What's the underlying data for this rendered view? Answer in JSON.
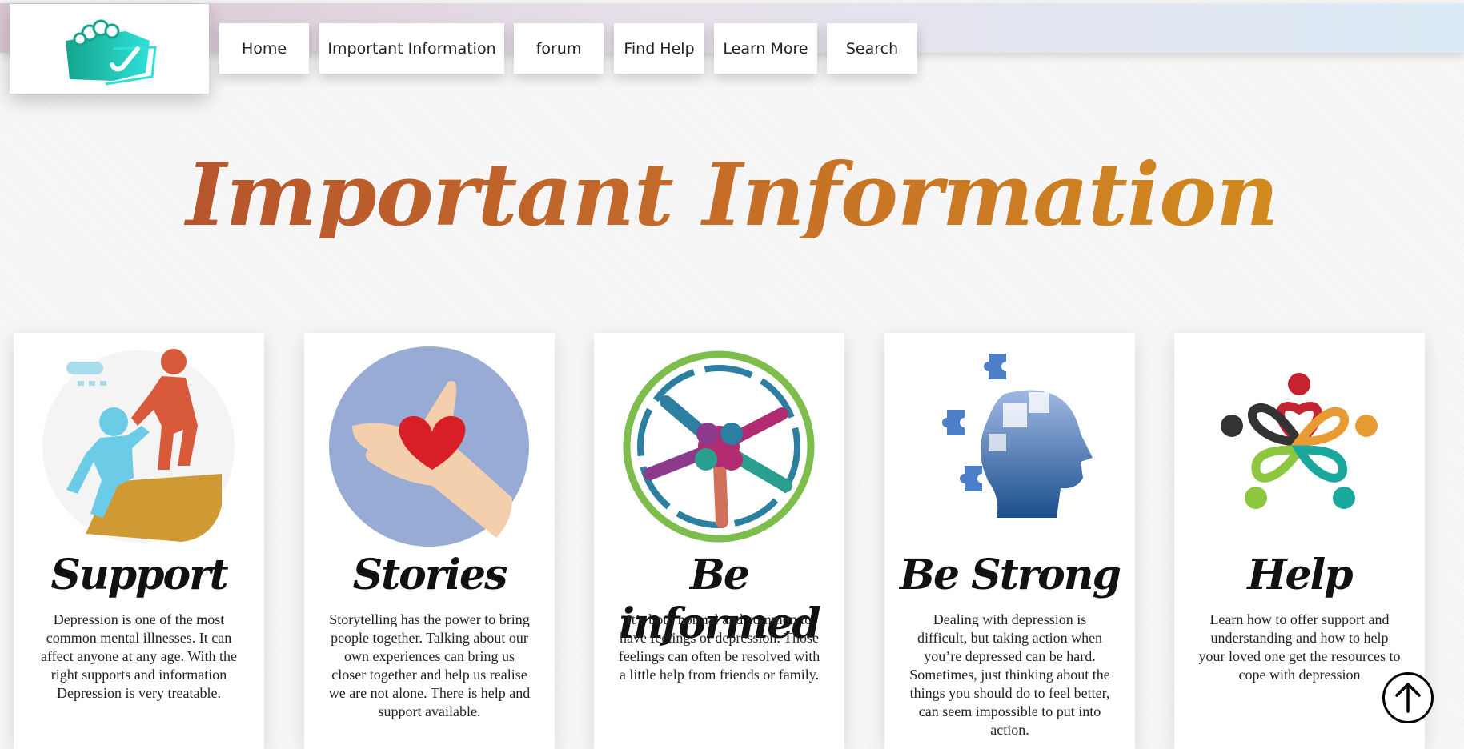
{
  "nav": {
    "items": [
      {
        "label": "Home"
      },
      {
        "label": "Important Information"
      },
      {
        "label": "forum"
      },
      {
        "label": "Find Help"
      },
      {
        "label": "Learn More"
      },
      {
        "label": "Search"
      }
    ]
  },
  "main": {
    "title": "Important Information",
    "cards": [
      {
        "title": "Support",
        "text": "Depression is one of the most common mental illnesses. It can affect anyone at any age. With the right supports and information Depression is very treatable."
      },
      {
        "title": "Stories",
        "text": "Storytelling has the power to bring people together. Talking about our own experiences can bring us closer together and help us realise we are not alone. There is help and support available."
      },
      {
        "title": "Be informed",
        "text": "It’s both normal and common to have feelings of depression. Those feelings can often be resolved with a little help from friends or family."
      },
      {
        "title": "Be Strong",
        "text": "Dealing with depression is difficult, but taking action when you’re depressed can be hard. Sometimes, just thinking about the things you should do to feel better, can seem impossible to put into action."
      },
      {
        "title": "Help",
        "text": "Learn how to offer support and understanding and how to help your loved one get the resources to cope with depression"
      }
    ]
  },
  "icons": {
    "logo": "hand-check-logo",
    "card_images": [
      "helping-hand-climb-icon",
      "heart-in-hand-icon",
      "joined-hands-circle-icon",
      "puzzle-head-icon",
      "community-hearts-icon"
    ],
    "scroll_top": "arrow-up-circle-icon"
  },
  "colors": {
    "title_gradient": [
      "#b24e2f",
      "#d6941c"
    ],
    "logo_teal": "#19b9a8"
  }
}
